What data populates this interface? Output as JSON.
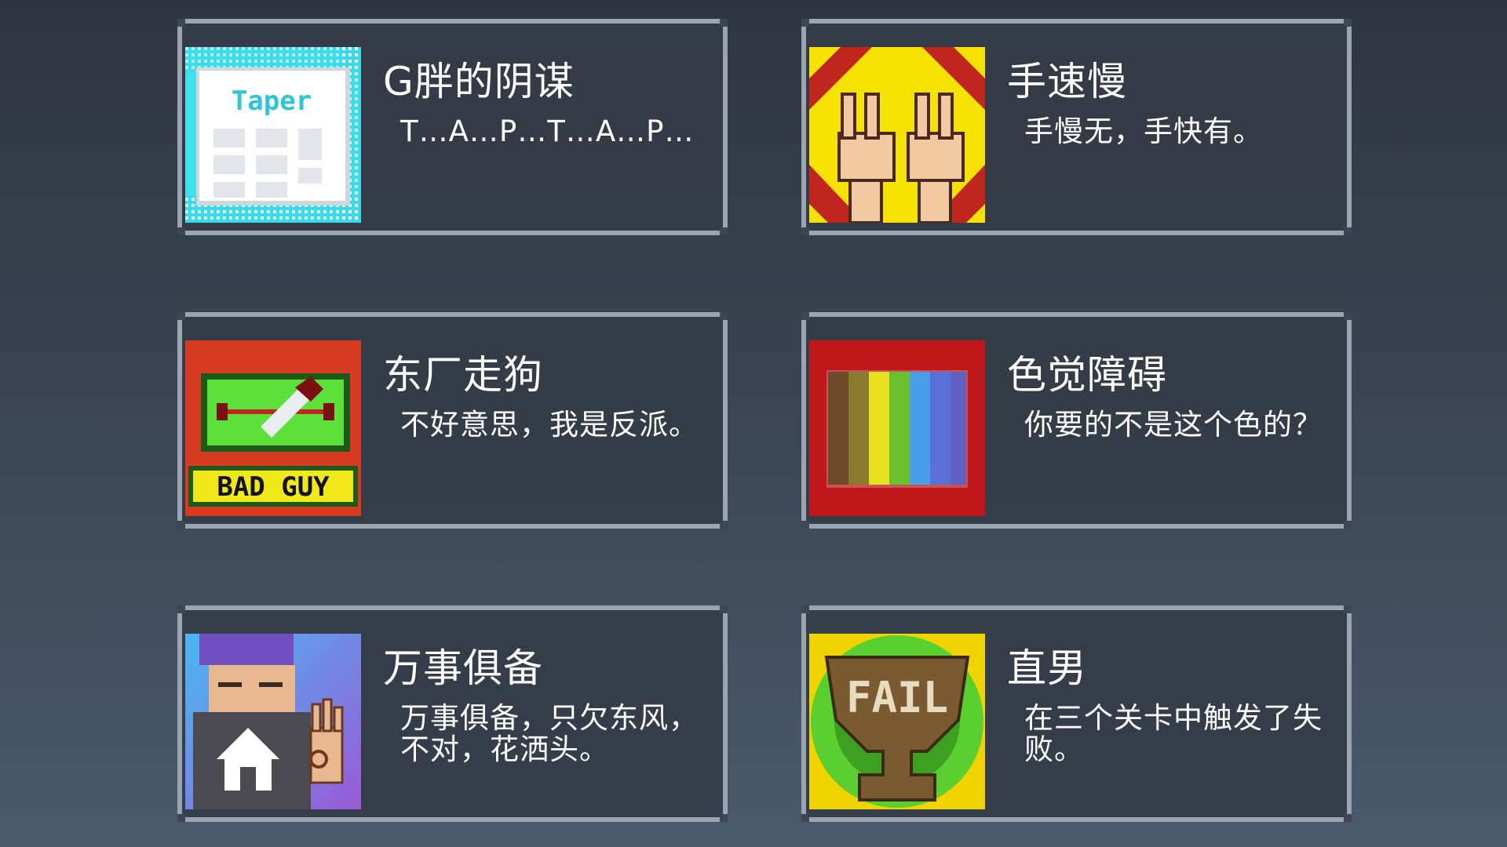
{
  "achievements": [
    {
      "title": "G胖的阴谋",
      "description": "T…A…P…T…A…P…",
      "icon": "taper-document-icon"
    },
    {
      "title": "手速慢",
      "description": "手慢无，手快有。",
      "icon": "peace-hands-icon"
    },
    {
      "title": "东厂走狗",
      "description": "不好意思，我是反派。",
      "icon": "bad-guy-knife-icon"
    },
    {
      "title": "色觉障碍",
      "description": "你要的不是这个色的？",
      "icon": "rainbow-colorblind-icon"
    },
    {
      "title": "万事俱备",
      "description": "万事俱备，只欠东风，不对，花洒头。",
      "icon": "ninja-ok-hand-icon"
    },
    {
      "title": "直男",
      "description": "在三个关卡中触发了失败。",
      "icon": "fail-trophy-icon"
    }
  ],
  "icon_texts": {
    "taper": "Taper",
    "bad_guy": "BAD GUY",
    "fail": "FAIL"
  },
  "colors": {
    "card_border": "#9aa5b1",
    "card_bg": "#343c48",
    "text": "#ffffff"
  }
}
